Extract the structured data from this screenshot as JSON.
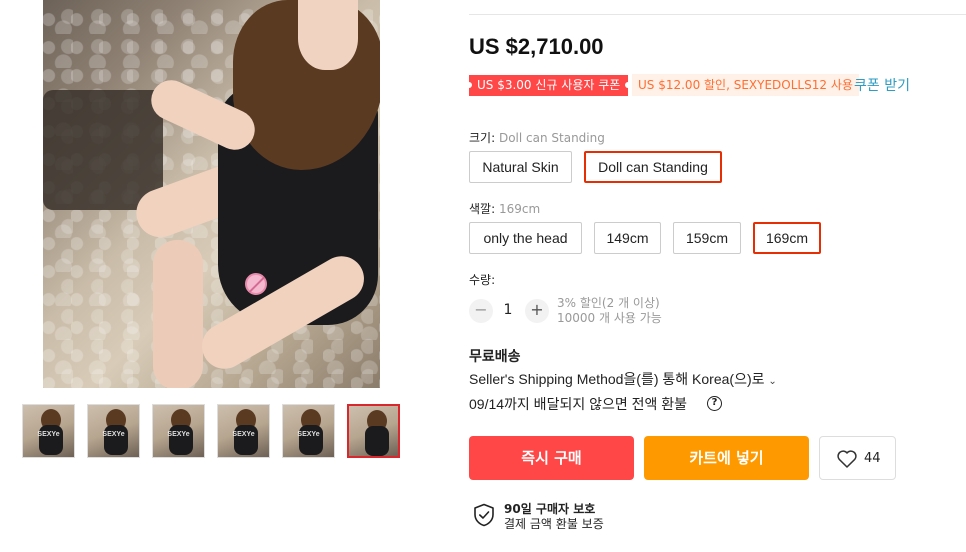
{
  "gallery": {
    "thumb_count": 6,
    "active_index": 5,
    "watermark": "SEXYe"
  },
  "price": "US $2,710.00",
  "coupons": {
    "new_user": "US $3.00 신규 사용자 쿠폰",
    "store": "US $12.00 할인, SEXYEDOLLS12 사용",
    "link": "쿠폰 받기"
  },
  "size": {
    "label": "크기:",
    "selected": "Doll can Standing",
    "options": [
      "Natural Skin",
      "Doll can Standing"
    ]
  },
  "color": {
    "label": "색깔:",
    "selected": "169cm",
    "options": [
      "only the head",
      "149cm",
      "159cm",
      "169cm"
    ]
  },
  "quantity": {
    "label": "수량:",
    "minus": "−",
    "value": "1",
    "plus": "+",
    "discount_note": "3% 할인(2 개 이상)",
    "available": "10000 개 사용 가능"
  },
  "shipping": {
    "title": "무료배송",
    "method": "Seller's Shipping Method을(를) 통해 Korea(으)로",
    "delivery": "09/14까지 배달되지 않으면 전액 환불",
    "help": "?"
  },
  "actions": {
    "buy_now": "즉시 구매",
    "add_to_cart": "카트에 넣기",
    "wishlist_count": "44"
  },
  "protection": {
    "title": "90일 구매자 보호",
    "subtitle": "결제 금액 환불 보증"
  },
  "colors": {
    "primary_red": "#ff4747",
    "cart_orange": "#ff9900",
    "selected_border": "#e62e04",
    "link_blue": "#2e9cc3"
  },
  "icons": {
    "help": "question-circle-icon",
    "wishlist": "heart-icon",
    "protection": "shield-check-icon",
    "dropdown": "chevron-down-icon"
  }
}
